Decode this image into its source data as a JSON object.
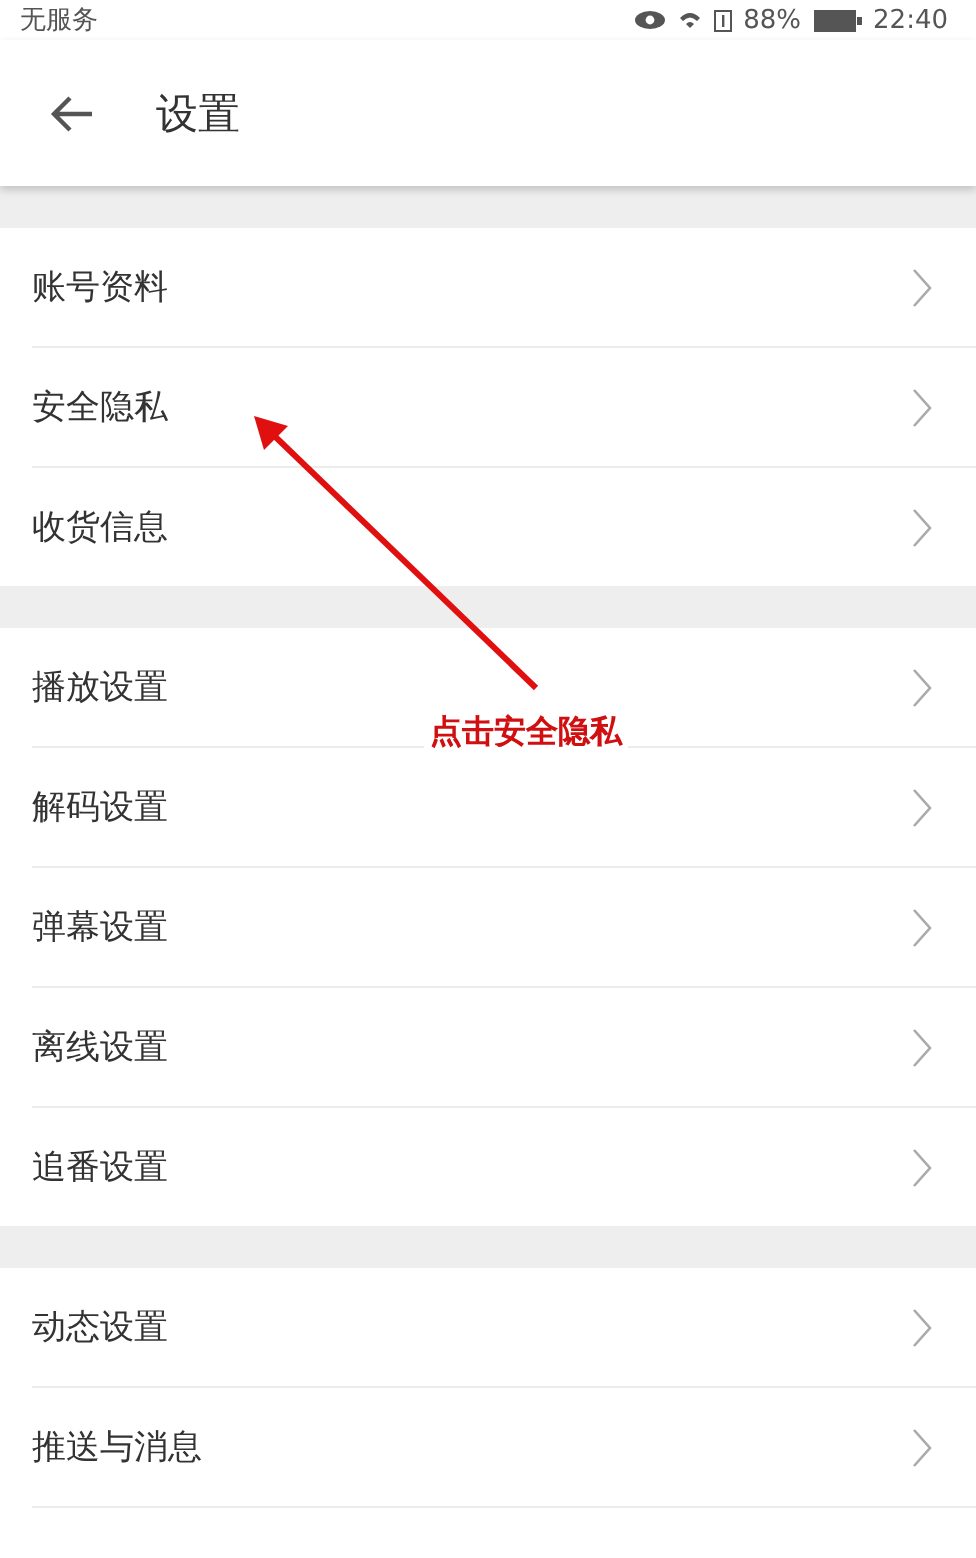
{
  "status_bar": {
    "carrier": "无服务",
    "battery": "88%",
    "time": "22:40"
  },
  "header": {
    "title": "设置"
  },
  "groups": [
    {
      "items": [
        {
          "label": "账号资料"
        },
        {
          "label": "安全隐私"
        },
        {
          "label": "收货信息"
        }
      ]
    },
    {
      "items": [
        {
          "label": "播放设置"
        },
        {
          "label": "解码设置"
        },
        {
          "label": "弹幕设置"
        },
        {
          "label": "离线设置"
        },
        {
          "label": "追番设置"
        }
      ]
    },
    {
      "items": [
        {
          "label": "动态设置"
        },
        {
          "label": "推送与消息"
        }
      ]
    }
  ],
  "annotation": {
    "label": "点击安全隐私"
  }
}
